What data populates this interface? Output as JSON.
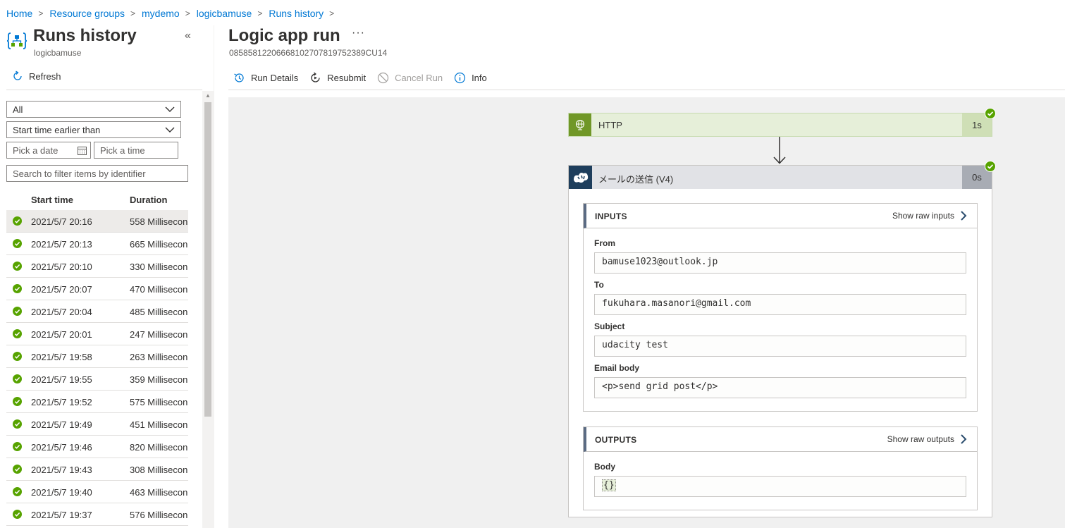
{
  "breadcrumb": [
    "Home",
    "Resource groups",
    "mydemo",
    "logicbamuse",
    "Runs history"
  ],
  "left": {
    "title": "Runs history",
    "subtitle": "logicbamuse",
    "collapse": "«",
    "refresh_label": "Refresh",
    "status_filter": "All",
    "time_filter": "Start time earlier than",
    "date_placeholder": "Pick a date",
    "time_placeholder": "Pick a time",
    "search_placeholder": "Search to filter items by identifier",
    "col_start": "Start time",
    "col_duration": "Duration",
    "runs": [
      {
        "time": "2021/5/7 20:16",
        "duration": "558 Millisecon"
      },
      {
        "time": "2021/5/7 20:13",
        "duration": "665 Millisecon"
      },
      {
        "time": "2021/5/7 20:10",
        "duration": "330 Millisecon"
      },
      {
        "time": "2021/5/7 20:07",
        "duration": "470 Millisecon"
      },
      {
        "time": "2021/5/7 20:04",
        "duration": "485 Millisecon"
      },
      {
        "time": "2021/5/7 20:01",
        "duration": "247 Millisecon"
      },
      {
        "time": "2021/5/7 19:58",
        "duration": "263 Millisecon"
      },
      {
        "time": "2021/5/7 19:55",
        "duration": "359 Millisecon"
      },
      {
        "time": "2021/5/7 19:52",
        "duration": "575 Millisecon"
      },
      {
        "time": "2021/5/7 19:49",
        "duration": "451 Millisecon"
      },
      {
        "time": "2021/5/7 19:46",
        "duration": "820 Millisecon"
      },
      {
        "time": "2021/5/7 19:43",
        "duration": "308 Millisecon"
      },
      {
        "time": "2021/5/7 19:40",
        "duration": "463 Millisecon"
      },
      {
        "time": "2021/5/7 19:37",
        "duration": "576 Millisecon"
      }
    ]
  },
  "right": {
    "title": "Logic app run",
    "more": "···",
    "run_id": "08585812206668102707819752389CU14",
    "toolbar": {
      "run_details": "Run Details",
      "resubmit": "Resubmit",
      "cancel_run": "Cancel Run",
      "info": "Info"
    }
  },
  "http_card": {
    "name": "HTTP",
    "duration": "1s"
  },
  "mail_card": {
    "name": "メールの送信 (V4)",
    "duration": "0s",
    "inputs_title": "INPUTS",
    "show_raw_inputs": "Show raw inputs",
    "from_label": "From",
    "from_value": "bamuse1023@outlook.jp",
    "to_label": "To",
    "to_value": "fukuhara.masanori@gmail.com",
    "subject_label": "Subject",
    "subject_value": "udacity test",
    "body_label": "Email body",
    "body_value": "<p>send grid post</p>",
    "outputs_title": "OUTPUTS",
    "show_raw_outputs": "Show raw outputs",
    "out_body_label": "Body",
    "out_body_value": "{}"
  },
  "colors": {
    "accent": "#0078d4",
    "success": "#57a300",
    "http": "#709727",
    "sendgrid": "#1e3e5c"
  }
}
